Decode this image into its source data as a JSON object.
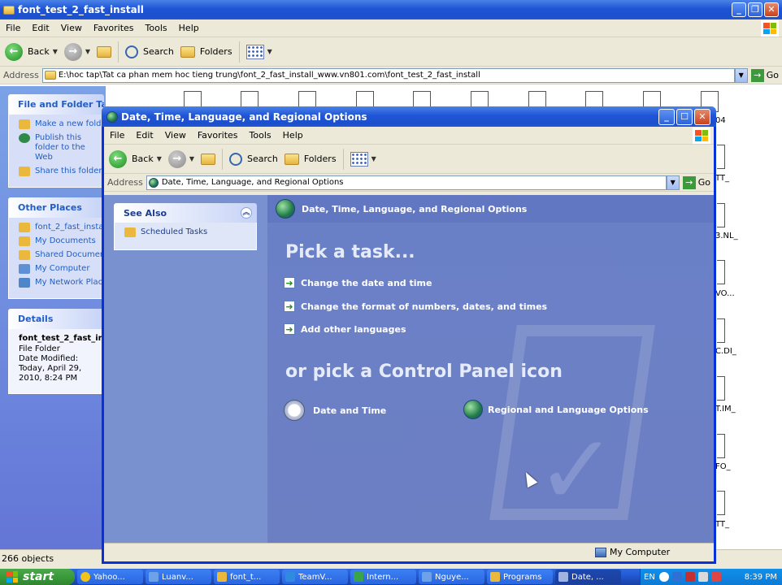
{
  "background_window": {
    "title": "font_test_2_fast_install",
    "menu": [
      "File",
      "Edit",
      "View",
      "Favorites",
      "Tools",
      "Help"
    ],
    "toolbar": {
      "back": "Back",
      "search": "Search",
      "folders": "Folders"
    },
    "address_label": "Address",
    "address_value": "E:\\hoc tap\\Tat ca phan mem hoc tieng trung\\font_2_fast_install_www.vn801.com\\font_test_2_fast_install",
    "go_label": "Go",
    "file_folder_tasks": {
      "title": "File and Folder Tasks",
      "items": [
        "Make a new folder",
        "Publish this folder to the Web",
        "Share this folder"
      ]
    },
    "other_places": {
      "title": "Other Places",
      "items": [
        "font_2_fast_install",
        "My Documents",
        "Shared Documents",
        "My Computer",
        "My Network Places"
      ]
    },
    "details": {
      "title": "Details",
      "name": "font_test_2_fast_install",
      "type": "File Folder",
      "modified": "Date Modified: Today, April 29, 2010, 8:24 PM"
    },
    "file_labels": [
      "04",
      "TT_",
      "3.NL_",
      "VO...",
      "C.DI_",
      "T.IM_",
      "FO_",
      "TT_"
    ],
    "status": "266 objects"
  },
  "dialog": {
    "title": "Date, Time, Language, and Regional Options",
    "menu": [
      "File",
      "Edit",
      "View",
      "Favorites",
      "Tools",
      "Help"
    ],
    "toolbar": {
      "back": "Back",
      "search": "Search",
      "folders": "Folders"
    },
    "address_label": "Address",
    "address_value": "Date, Time, Language, and Regional Options",
    "go_label": "Go",
    "see_also": {
      "title": "See Also",
      "items": [
        "Scheduled Tasks"
      ]
    },
    "category_title": "Date, Time, Language, and Regional Options",
    "pick_task": "Pick a task...",
    "tasks": [
      "Change the date and time",
      "Change the format of numbers, dates, and times",
      "Add other languages"
    ],
    "pick_icon": "or pick a Control Panel icon",
    "icons": [
      "Date and Time",
      "Regional and Language Options"
    ],
    "status_location": "My Computer"
  },
  "taskbar": {
    "start": "start",
    "buttons": [
      "Yahoo...",
      "Luanv...",
      "font_t...",
      "TeamV...",
      "Intern...",
      "Nguye...",
      "Programs",
      "Date, ..."
    ],
    "language": "EN",
    "time": "8:39 PM"
  },
  "colors": {
    "xp_blue": "#0831d9",
    "task_pane": "#6a80c7",
    "start_green": "#3a9a3a"
  }
}
